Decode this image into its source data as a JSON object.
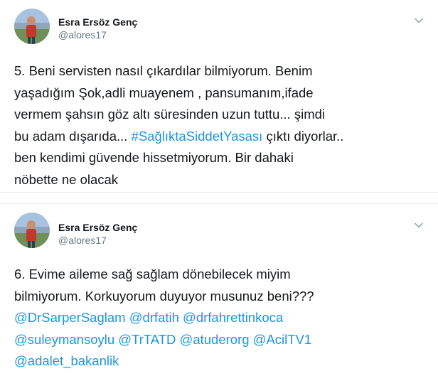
{
  "tweets": [
    {
      "author": {
        "name": "Esra Ersöz Genç",
        "handle": "@alores17"
      },
      "lines": [
        [
          {
            "text": "5. Beni servisten nasıl çıkardılar bilmiyorum. Benim",
            "link": false
          }
        ],
        [
          {
            "text": "yaşadığım Şok,adli muayenem , pansumanım,ifade",
            "link": false
          }
        ],
        [
          {
            "text": "vermem şahsın göz altı süresinden uzun tuttu... şimdi",
            "link": false
          }
        ],
        [
          {
            "text": "bu adam dışarıda... ",
            "link": false
          },
          {
            "text": "#SağlıktaSiddetYasası",
            "link": true
          },
          {
            "text": " çıktı diyorlar..",
            "link": false
          }
        ],
        [
          {
            "text": "ben kendimi güvende hissetmiyorum. Bir dahaki",
            "link": false
          }
        ],
        [
          {
            "text": "nöbette ne olacak",
            "link": false
          }
        ]
      ]
    },
    {
      "author": {
        "name": "Esra Ersöz Genç",
        "handle": "@alores17"
      },
      "lines": [
        [
          {
            "text": "6. Evime aileme sağ sağlam dönebilecek miyim",
            "link": false
          }
        ],
        [
          {
            "text": "bilmiyorum. Korkuyorum duyuyor musunuz beni???",
            "link": false
          }
        ],
        [
          {
            "text": "@DrSarperSaglam",
            "link": true
          },
          {
            "text": " ",
            "link": false
          },
          {
            "text": "@drfatih",
            "link": true
          },
          {
            "text": " ",
            "link": false
          },
          {
            "text": "@drfahrettinkoca",
            "link": true
          }
        ],
        [
          {
            "text": "@suleymansoylu",
            "link": true
          },
          {
            "text": " ",
            "link": false
          },
          {
            "text": "@TrTATD",
            "link": true
          },
          {
            "text": " ",
            "link": false
          },
          {
            "text": "@atuderorg",
            "link": true
          },
          {
            "text": " ",
            "link": false
          },
          {
            "text": "@AcilTV1",
            "link": true
          }
        ],
        [
          {
            "text": "@adalet_bakanlik",
            "link": true
          }
        ]
      ]
    }
  ],
  "colors": {
    "text": "#14171a",
    "muted": "#657786",
    "link": "#1b95e0",
    "border": "#e6ecf0"
  },
  "icons": {
    "menu": "chevron-down-icon"
  }
}
